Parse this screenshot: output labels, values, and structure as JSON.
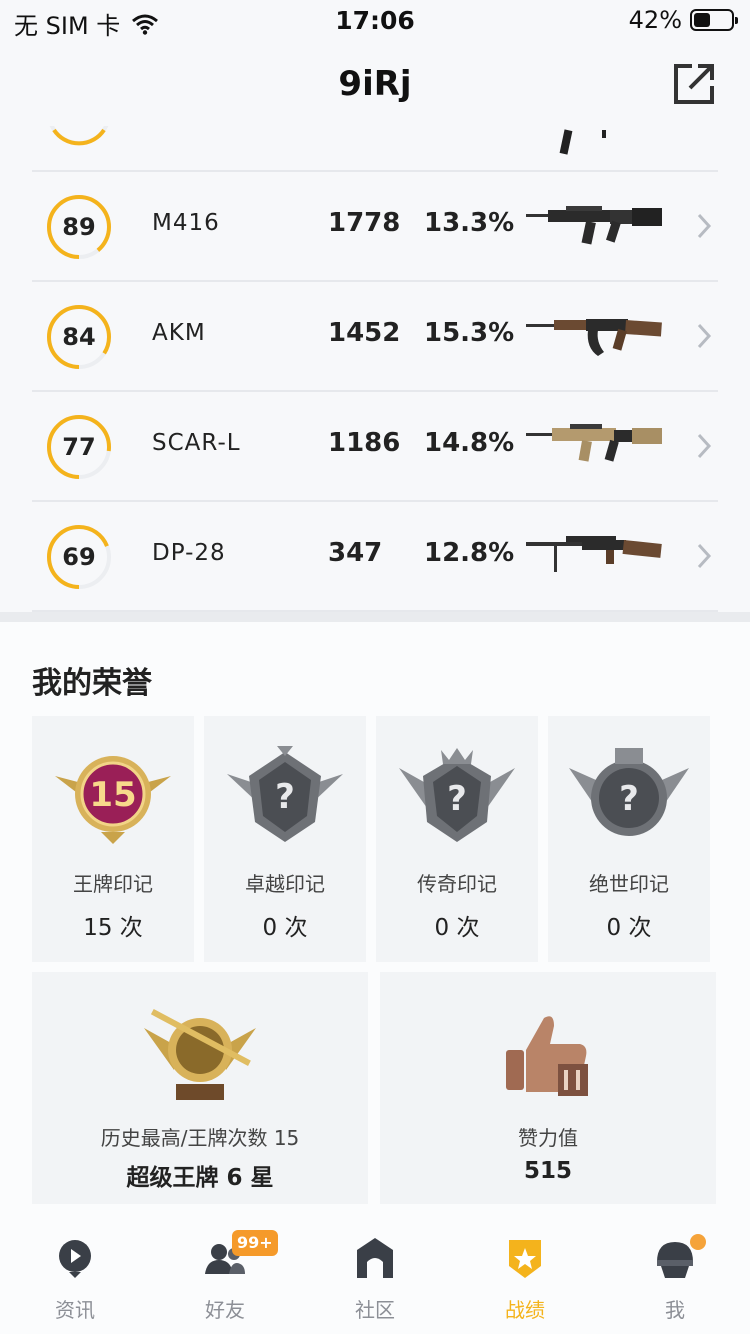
{
  "status_bar": {
    "carrier": "无 SIM 卡",
    "time": "17:06",
    "battery": "42%"
  },
  "nav": {
    "title": "9iRj"
  },
  "weapons": [
    {
      "score": "89",
      "name": "M416",
      "kills": "1778",
      "rate": "13.3%",
      "progress": 0.89
    },
    {
      "score": "84",
      "name": "AKM",
      "kills": "1452",
      "rate": "15.3%",
      "progress": 0.84
    },
    {
      "score": "77",
      "name": "SCAR-L",
      "kills": "1186",
      "rate": "14.8%",
      "progress": 0.77
    },
    {
      "score": "69",
      "name": "DP-28",
      "kills": "347",
      "rate": "12.8%",
      "progress": 0.69
    }
  ],
  "honors": {
    "title": "我的荣誉",
    "badges": [
      {
        "name": "王牌印记",
        "count": "15 次",
        "level": "15"
      },
      {
        "name": "卓越印记",
        "count": "0 次"
      },
      {
        "name": "传奇印记",
        "count": "0 次"
      },
      {
        "name": "绝世印记",
        "count": "0 次"
      }
    ],
    "best": {
      "label": "历史最高/王牌次数 15",
      "value": "超级王牌 6 星"
    },
    "likes": {
      "label": "赞力值",
      "value": "515"
    }
  },
  "tabs": [
    {
      "label": "资讯",
      "active": false
    },
    {
      "label": "好友",
      "badge": "99+",
      "active": false
    },
    {
      "label": "社区",
      "active": false
    },
    {
      "label": "战绩",
      "active": true
    },
    {
      "label": "我",
      "active": false
    }
  ],
  "colors": {
    "accent": "#f4b31c",
    "ring_track": "#eceef1",
    "badge_orange": "#f59a2a"
  }
}
